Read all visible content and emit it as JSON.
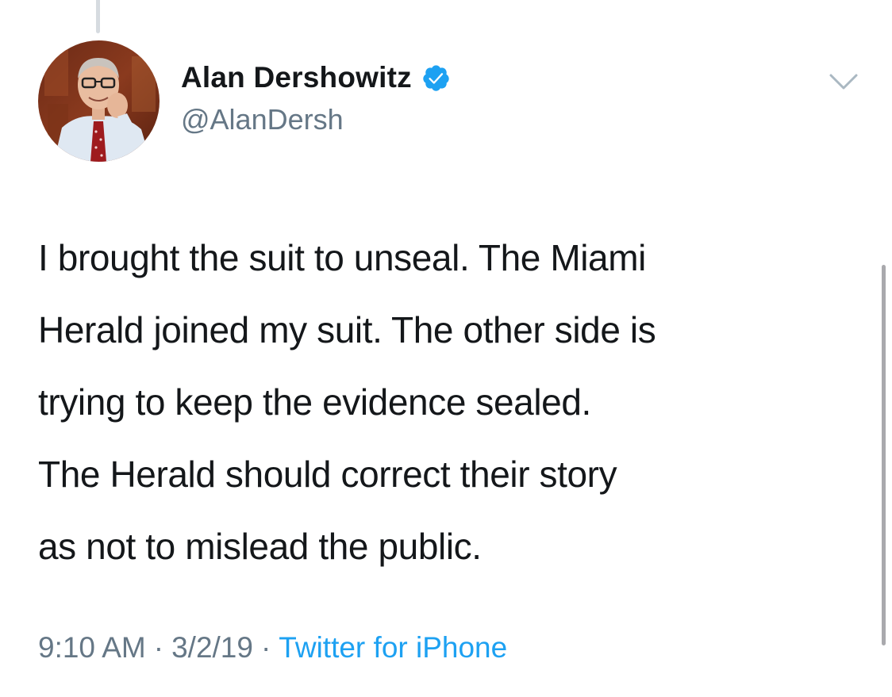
{
  "author": {
    "display_name": "Alan Dershowitz",
    "handle": "@AlanDersh",
    "verified": true,
    "avatar_icon": "profile-photo"
  },
  "tweet": {
    "lines": [
      "I brought the suit to unseal. The Miami",
      "Herald joined my suit. The other side is",
      "trying to keep the evidence sealed.",
      "The Herald should correct their story",
      "as not to mislead the public."
    ]
  },
  "meta": {
    "time": "9:10 AM",
    "separator": "·",
    "date": "3/2/19",
    "source": "Twitter for iPhone"
  },
  "colors": {
    "text": "#14171a",
    "secondary": "#657786",
    "accent": "#1da1f2"
  },
  "icons": {
    "verified": "verified-badge-icon",
    "menu": "chevron-down-icon"
  }
}
